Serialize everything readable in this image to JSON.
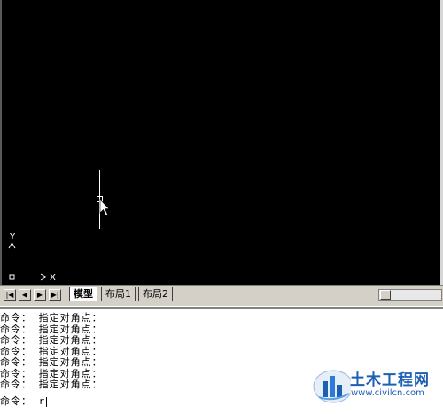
{
  "viewport": {
    "ucs": {
      "y_label": "Y",
      "x_label": "X"
    }
  },
  "tabs": [
    {
      "label": "模型",
      "active": true
    },
    {
      "label": "布局1",
      "active": false
    },
    {
      "label": "布局2",
      "active": false
    }
  ],
  "command_history": [
    "命令： 指定对角点：",
    "命令： 指定对角点：",
    "命令： 指定对角点：",
    "命令： 指定对角点：",
    "命令： 指定对角点：",
    "命令： 指定对角点：",
    "命令： 指定对角点："
  ],
  "command_prompt": {
    "label": "命令：",
    "input": "r"
  },
  "watermark": {
    "text": "土木工程网",
    "url": "www.civilcn.com"
  },
  "colors": {
    "canvas": "#000000",
    "crosshair": "#ffffff",
    "panel": "#d4d0c8",
    "watermark": "#1d5fb3"
  }
}
